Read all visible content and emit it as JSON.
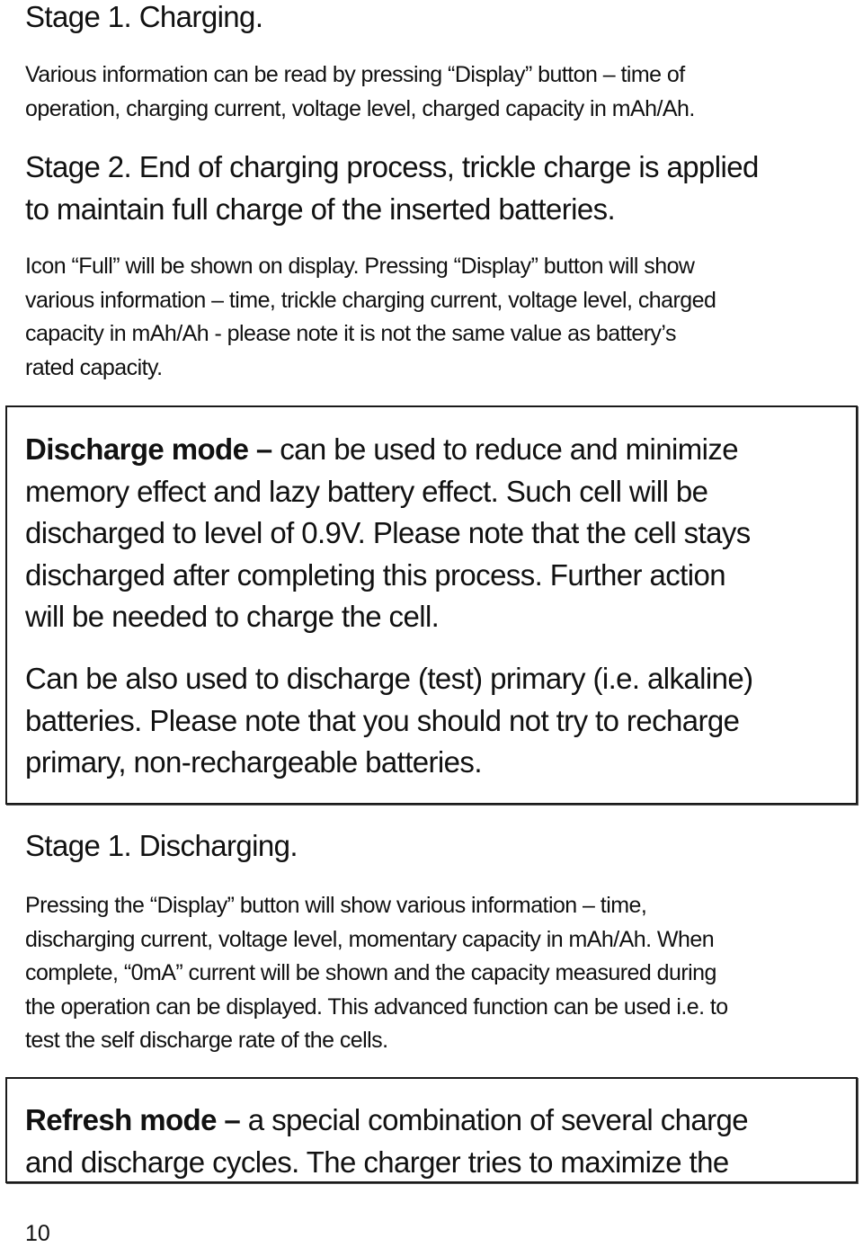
{
  "stage1_charging": {
    "heading": "Stage 1. Charging.",
    "lines": [
      "Various information can be read by pressing “Display” button – time of",
      "operation, charging current, voltage level, charged capacity in mAh/Ah."
    ]
  },
  "stage2_charging": {
    "lines": [
      "Stage 2. End of charging process, trickle charge is applied",
      "to maintain full charge of the inserted batteries."
    ],
    "detail_lines": [
      "Icon “Full” will be shown on display. Pressing “Display” button will show",
      "various information – time, trickle charging current, voltage level, charged",
      "capacity in mAh/Ah - please note it is not the same value as battery’s",
      "rated capacity."
    ]
  },
  "discharge_box": {
    "title": "Discharge mode –",
    "first_line_rest": " can be used to reduce and minimize",
    "lines": [
      "memory effect and lazy battery effect. Such cell will be",
      "discharged to level of 0.9V. Please note that the cell stays",
      "discharged after completing this process. Further action",
      "will be needed to charge the cell."
    ],
    "note_lines": [
      "Can be also used to discharge (test) primary (i.e. alkaline)",
      "batteries. Please note that you should not try to recharge",
      "primary, non-rechargeable batteries."
    ]
  },
  "stage1_discharging": {
    "heading": "Stage 1. Discharging.",
    "lines": [
      "Pressing the “Display” button will show various information – time,",
      "discharging current, voltage level, momentary capacity in mAh/Ah. When",
      "complete, “0mA” current will be shown and the capacity measured during",
      "the operation can be displayed. This advanced function can be used i.e. to",
      "test the self discharge rate of the cells."
    ]
  },
  "refresh_box": {
    "title": "Refresh mode –",
    "first_line_rest": " a special combination of several charge",
    "lines": [
      "and discharge cycles. The charger tries to maximize the"
    ]
  },
  "page_number": "10"
}
